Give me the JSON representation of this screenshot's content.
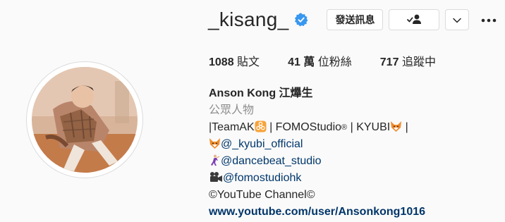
{
  "profile": {
    "username": "_kisang_",
    "verified": true,
    "message_button": "發送訊息",
    "follow_icon": "person-check-icon",
    "dropdown_icon": "chevron-down-icon",
    "more_icon": "more-dots-icon"
  },
  "stats": {
    "posts_count": "1088",
    "posts_label": "貼文",
    "followers_count": "41 萬",
    "followers_label": "位粉絲",
    "following_count": "717",
    "following_label": "追蹤中"
  },
  "bio": {
    "full_name": "Anson Kong 江𤒹生",
    "category": "公眾人物",
    "line1_a": "|TeamAK",
    "line1_b": " | FOMOStudio",
    "line1_c": " | KYUBI",
    "line1_d": " |",
    "line2_mention": "@_kyubi_official",
    "line3_mention": "@dancebeat_studio",
    "line4_mention": "@fomostudiohk",
    "line5": "©YouTube Channel©",
    "website": "www.youtube.com/user/Ansonkong1016"
  },
  "colors": {
    "accent_verified": "#3897f0",
    "link": "#003569",
    "secondary_text": "#8e8e8e",
    "border": "#dbdbdb"
  }
}
